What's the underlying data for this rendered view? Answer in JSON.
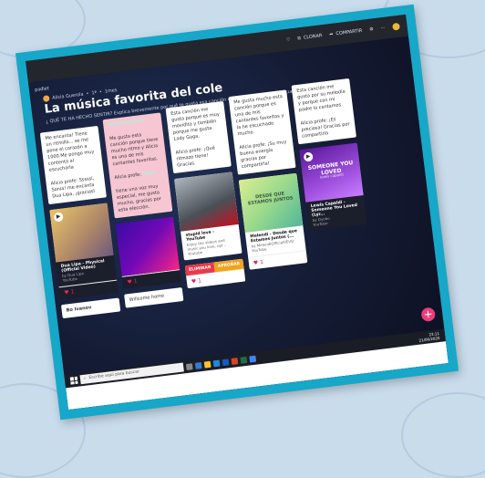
{
  "topbar": {
    "clone_label": "CLONAR",
    "share_label": "COMPARTIR"
  },
  "app": {
    "logo": "padlet"
  },
  "breadcrumb": {
    "author": "Alicia Guerola",
    "separator": "•",
    "time": "1ª",
    "extra": "1mes"
  },
  "board": {
    "title": "La música favorita del cole",
    "subtitle": "¿ QUÉ TE HA HECHO SENTIR? Explica brevemente por qué te gusta esa canción o pieza ( sentimientos, recuerdos etc...)"
  },
  "columns": [
    {
      "cards": [
        {
          "type": "text",
          "text": "Me encanta! Tiene un ritmillo... se me pone el corazón a 1000.Me pongo muy contenta al escucharla",
          "reply": "Alicia profe: Sssssí, Sonia! me encanta Dua Lipa, ¡graciasl"
        },
        {
          "type": "media",
          "title": "Dua Lipa - Physical (Official Video)",
          "meta1": "by Dua Lipa",
          "meta2": "YouTube",
          "likes": "1"
        },
        {
          "type": "text",
          "text": "Bo Ivanov"
        }
      ]
    },
    {
      "cards": [
        {
          "type": "pink",
          "text": "Me gusta esta canción porque tiene mucho ritmo y Alicia es una de mis cantantes favoritas.",
          "reply_label": "Alicia profe:",
          "reply": "tiene una voz muy especial, me gusta mucho, gracias por esta elección."
        },
        {
          "type": "media",
          "likes": "1"
        },
        {
          "type": "text",
          "text": "Willcome home"
        }
      ]
    },
    {
      "cards": [
        {
          "type": "text",
          "text": "Esta canción me gusta porque es muy movidita y también porque me gusta Lady Gaga.",
          "reply": "Alicia profe: ¡Qué ritmazo tiene! Gracias."
        },
        {
          "type": "media",
          "title": "stupid love - YouTube",
          "meta1": "Enjoy the videos and music you love, upl...",
          "meta2": "Youtube"
        },
        {
          "type": "buttons",
          "delete": "ELIMINAR",
          "approve": "APROBAR",
          "likes": "1"
        }
      ]
    },
    {
      "cards": [
        {
          "type": "text",
          "text": "Me gusta mucho esta canción porque es una de mis cantantes favoritos y la he escuchado mucho.",
          "reply": "Alicia profe: ¡Su muy buena energía gracias por compartirla!"
        },
        {
          "type": "media",
          "overlay": "DESDE QUE ESTAMOS JUNTOS",
          "title": "Melendi - Desde que Estamos Juntos (...",
          "meta1": "by MelendiOfficialVEVO",
          "meta2": "YouTube",
          "likes": "1"
        }
      ]
    },
    {
      "cards": [
        {
          "type": "text",
          "text": "Esta canción me gusta por su melodía y porque con mi padre la cantamos",
          "reply": "Alicia profe: ¡Es preciosa! Gracias por compartirla"
        },
        {
          "type": "media",
          "overlay": "SOMEONE YOU LOVED",
          "overlay_sub": "lewis capaldi",
          "title": "Lewis Capaldi - Someone You Loved (Lyr...",
          "meta1": "by Dyobo",
          "meta2": "YouTube",
          "likes": "1"
        }
      ]
    }
  ],
  "fab": "+",
  "taskbar": {
    "search_placeholder": "Escribe aquí para buscar",
    "time": "23:11",
    "date": "21/06/2020"
  }
}
